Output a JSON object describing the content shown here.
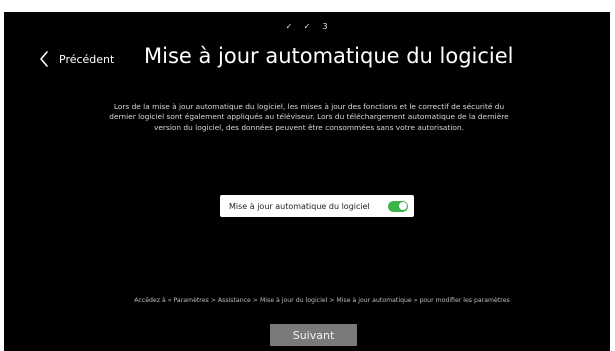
{
  "steps": {
    "step1": "✓",
    "step2": "✓",
    "step3": "3"
  },
  "header": {
    "back_label": "Précédent",
    "back_icon": "chevron-left-icon",
    "title": "Mise à jour automatique du logiciel"
  },
  "description": {
    "line1": "Lors de la mise à jour automatique du logiciel, les mises à jour des fonctions et le correctif de sécurité du",
    "line2": "dernier logiciel sont également appliqués au téléviseur. Lors du téléchargement automatique de la dernière",
    "line3": "version du logiciel, des données peuvent être consommées sans votre autorisation."
  },
  "auto_update": {
    "label": "Mise à jour automatique du logiciel",
    "enabled": true,
    "switch_color": "#3cb44b"
  },
  "hint": "Accédez à « Paramètres > Assistance > Mise à jour du logiciel > Mise à jour automatique » pour modifier les paramètres",
  "footer": {
    "next_label": "Suivant"
  },
  "colors": {
    "background": "#000000",
    "button": "#7a7a7a"
  }
}
